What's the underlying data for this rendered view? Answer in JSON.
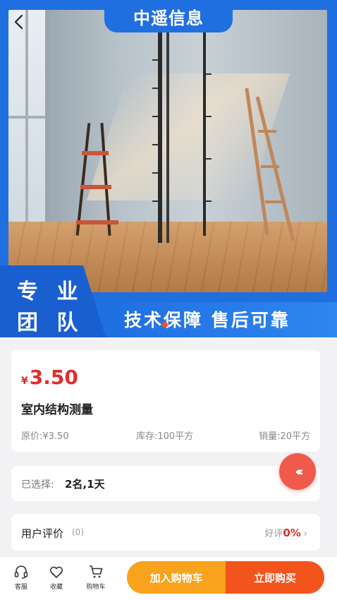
{
  "header": {
    "title": "中遥信息",
    "back_icon": "chevron-left-icon"
  },
  "banner": {
    "slogan_line1": "专 业",
    "slogan_line2": "团 队",
    "slogan_text": "技术保障 售后可靠",
    "accent_color": "#1f6fe0"
  },
  "product": {
    "currency_symbol": "¥",
    "price": "3.50",
    "name": "室内结构测量",
    "original_price": "原价:¥3.50",
    "stock": "库存:100平方",
    "sales": "销量:20平方",
    "price_color": "#e02d2d"
  },
  "selection": {
    "label": "已选择:",
    "value": "2名,1天"
  },
  "float_button": {
    "icon": "triple-chevron-left-icon",
    "glyph": "‹‹‹"
  },
  "reviews": {
    "label": "用户评价",
    "count": "(0)",
    "good_rate_label": "好评",
    "good_rate_value": "0%",
    "chevron": "›"
  },
  "bottom_bar": {
    "service_label": "客服",
    "favorite_label": "收藏",
    "cart_label": "购物车",
    "add_to_cart": "加入购物车",
    "buy_now": "立即购买",
    "add_color": "#f9a21c",
    "buy_color": "#f3541c"
  }
}
